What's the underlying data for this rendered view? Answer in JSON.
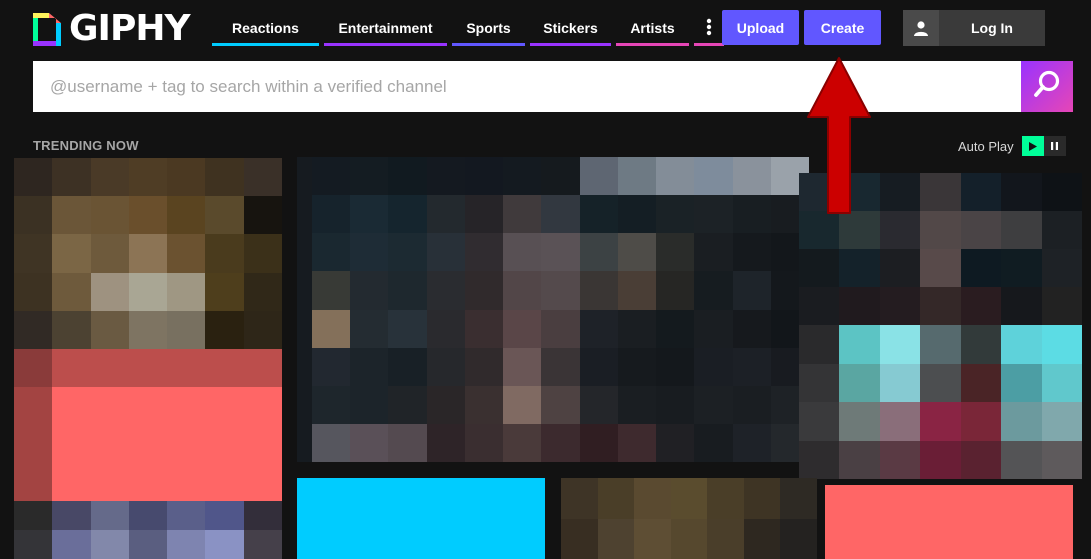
{
  "brand": {
    "name": "GIPHY",
    "colors": [
      "#00ff99",
      "#00ccff",
      "#9933ff",
      "#ff6666",
      "#fff35c"
    ]
  },
  "nav": {
    "items": [
      {
        "label": "Reactions",
        "color": "#00ccff"
      },
      {
        "label": "Entertainment",
        "color": "#9933ff"
      },
      {
        "label": "Sports",
        "color": "#6157ff"
      },
      {
        "label": "Stickers",
        "color": "#9933ff"
      },
      {
        "label": "Artists",
        "color": "#e646b6"
      }
    ],
    "more_icon": "more-vertical-icon",
    "more_color": "#e646b6"
  },
  "header": {
    "upload_label": "Upload",
    "create_label": "Create",
    "login_label": "Log In",
    "user_icon": "user-icon",
    "accent": "#6157ff"
  },
  "search": {
    "placeholder": "@username + tag to search within a verified channel",
    "value": "",
    "icon": "search-icon"
  },
  "trending": {
    "label": "TRENDING NOW"
  },
  "autoplay": {
    "label": "Auto Play",
    "play_icon": "play-icon",
    "pause_icon": "pause-icon",
    "active_color": "#00ff99"
  },
  "annotation": {
    "arrow_color": "#cc0000",
    "icon": "arrow-up-icon"
  }
}
